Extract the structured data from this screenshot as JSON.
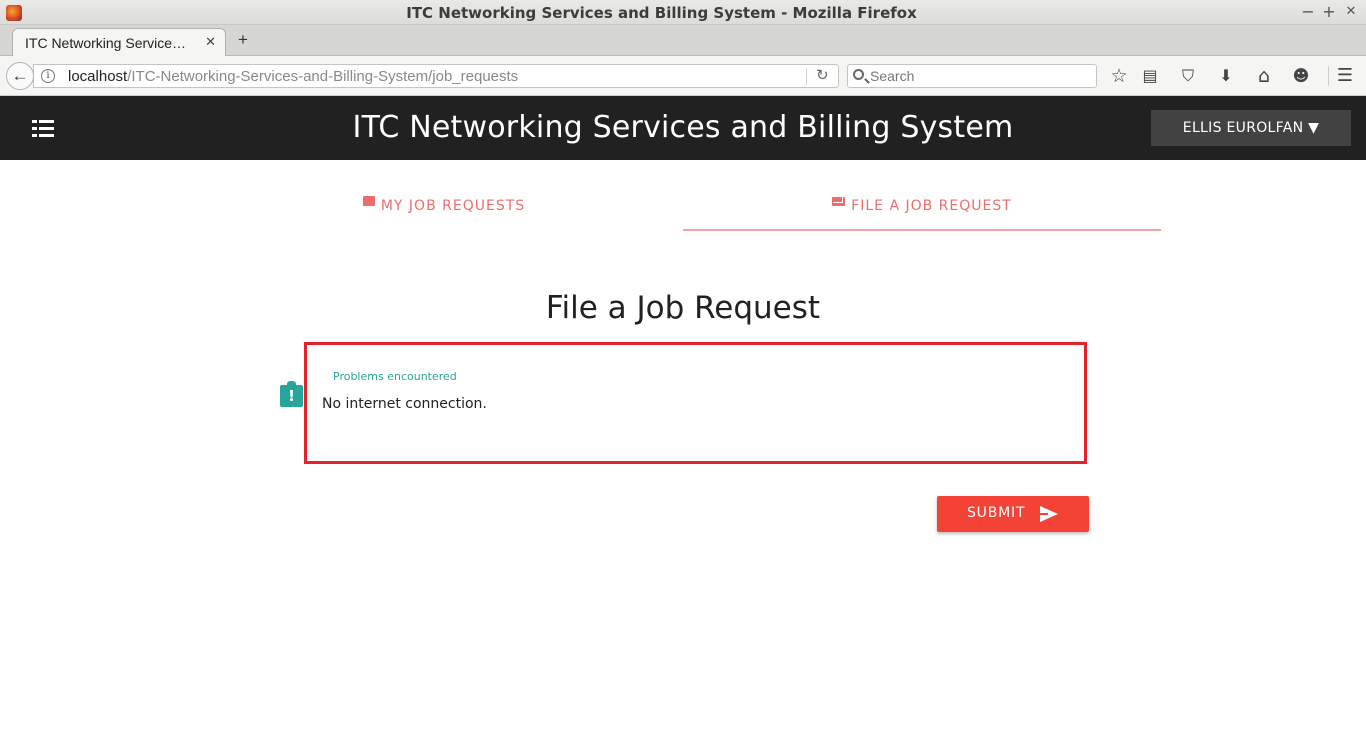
{
  "window": {
    "title": "ITC Networking Services and Billing System - Mozilla Firefox",
    "controls": {
      "minimize": "−",
      "maximize": "+",
      "close": "✕"
    }
  },
  "browser": {
    "tab_label": "ITC Networking Service…",
    "tab_close": "✕",
    "new_tab": "+",
    "back": "←",
    "url_host": "localhost",
    "url_path": "/ITC-Networking-Services-and-Billing-System/job_requests",
    "reload": "↻",
    "search_placeholder": "Search",
    "toolbar_icons": {
      "bookmark_star": "☆",
      "reading_list": "▤",
      "pocket": "⛉",
      "downloads": "⬇",
      "home": "⌂",
      "chat": "☻",
      "menu": "☰"
    }
  },
  "app": {
    "title": "ITC Networking Services and Billing System",
    "user_menu": "ELLIS EUROLFAN ▼",
    "tabs": [
      {
        "label": "MY JOB REQUESTS",
        "icon": "chat-bubble-icon"
      },
      {
        "label": "FILE A JOB REQUEST",
        "icon": "mail-icon"
      }
    ],
    "form": {
      "heading": "File a Job Request",
      "field_label": "Problems encountered",
      "field_value": "No internet connection.",
      "field_icon_mark": "!",
      "submit_label": "SUBMIT"
    }
  },
  "colors": {
    "appbar": "#212121",
    "accent_tab": "#ef6c6c",
    "teal": "#26a69a",
    "submit": "#f44336",
    "highlight_border": "#e3222c"
  }
}
